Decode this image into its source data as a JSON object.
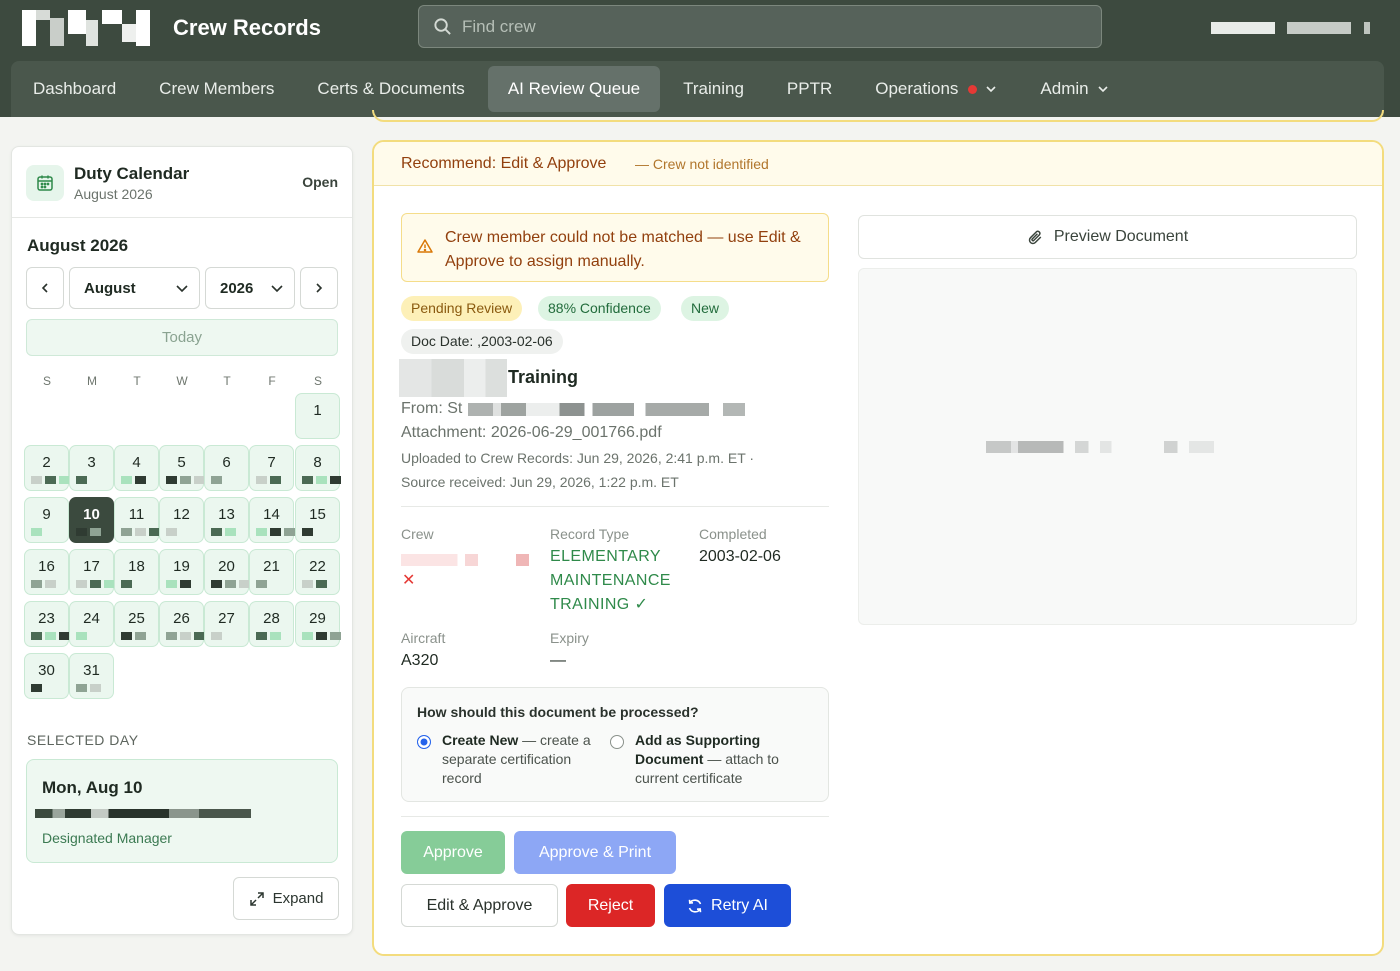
{
  "app": {
    "title": "Crew Records"
  },
  "search": {
    "placeholder": "Find crew"
  },
  "nav": {
    "items": [
      {
        "label": "Dashboard"
      },
      {
        "label": "Crew Members"
      },
      {
        "label": "Certs & Documents"
      },
      {
        "label": "AI Review Queue"
      },
      {
        "label": "Training"
      },
      {
        "label": "PPTR"
      },
      {
        "label": "Operations"
      },
      {
        "label": "Admin"
      }
    ],
    "active": "AI Review Queue"
  },
  "calendar": {
    "title": "Duty Calendar",
    "subtitle": "August 2026",
    "status": "Open",
    "month_heading": "August 2026",
    "month_select": "August",
    "year_select": "2026",
    "today_label": "Today",
    "weekdays": [
      "S",
      "M",
      "T",
      "W",
      "T",
      "F",
      "S"
    ],
    "days": [
      "1",
      "2",
      "3",
      "4",
      "5",
      "6",
      "7",
      "8",
      "9",
      "10",
      "11",
      "12",
      "13",
      "14",
      "15",
      "16",
      "17",
      "18",
      "19",
      "20",
      "21",
      "22",
      "23",
      "24",
      "25",
      "26",
      "27",
      "28",
      "29",
      "30",
      "31"
    ],
    "selected_day": "10",
    "selected_section_label": "SELECTED DAY",
    "selected_date": "Mon, Aug 10",
    "selected_role": "Designated Manager",
    "expand_label": "Expand"
  },
  "review": {
    "recommend_label": "Recommend: Edit & Approve",
    "recommend_note": "— Crew not identified",
    "warning": "Crew member could not be matched — use Edit & Approve to assign manually.",
    "badges": {
      "status": "Pending Review",
      "confidence": "88% Confidence",
      "new": "New",
      "doc_date": "Doc Date: ,2003-02-06"
    },
    "doc_title": "Training",
    "from_label": "From: St",
    "attachment": "Attachment: 2026-06-29_001766.pdf",
    "uploaded": "Uploaded to Crew Records: Jun 29, 2026, 2:41 p.m. ET  ·",
    "source_received": "Source received: Jun 29, 2026, 1:22 p.m. ET",
    "fields": {
      "crew_label": "Crew",
      "record_type_label": "Record Type",
      "record_type_lines": [
        "ELEMENTARY",
        "MAINTENANCE",
        "TRAINING ✓"
      ],
      "completed_label": "Completed",
      "completed_value": "2003-02-06",
      "aircraft_label": "Aircraft",
      "aircraft_value": "A320",
      "expiry_label": "Expiry",
      "expiry_value": "—"
    },
    "process": {
      "question": "How should this document be processed?",
      "opt1_bold": "Create New",
      "opt1_rest": " — create a separate certification record",
      "opt2_bold": "Add as Supporting Document",
      "opt2_rest": " — attach to current certificate",
      "selected": "Create New"
    },
    "buttons": {
      "approve": "Approve",
      "approve_print": "Approve & Print",
      "edit_approve": "Edit & Approve",
      "reject": "Reject",
      "retry": "Retry AI"
    },
    "preview_label": "Preview Document"
  },
  "colors": {
    "header_bg": "#3d4a3f",
    "nav_bg": "#4a574c",
    "accent_green": "#2f8a4a",
    "warning_border": "#f3dc7e",
    "reject_red": "#dc2626",
    "retry_blue": "#1d4ed8"
  },
  "icons": [
    "search-icon",
    "calendar-icon",
    "chevron-left-icon",
    "chevron-right-icon",
    "chevron-down-icon",
    "warning-icon",
    "paperclip-icon",
    "refresh-icon",
    "expand-icon",
    "close-icon"
  ]
}
